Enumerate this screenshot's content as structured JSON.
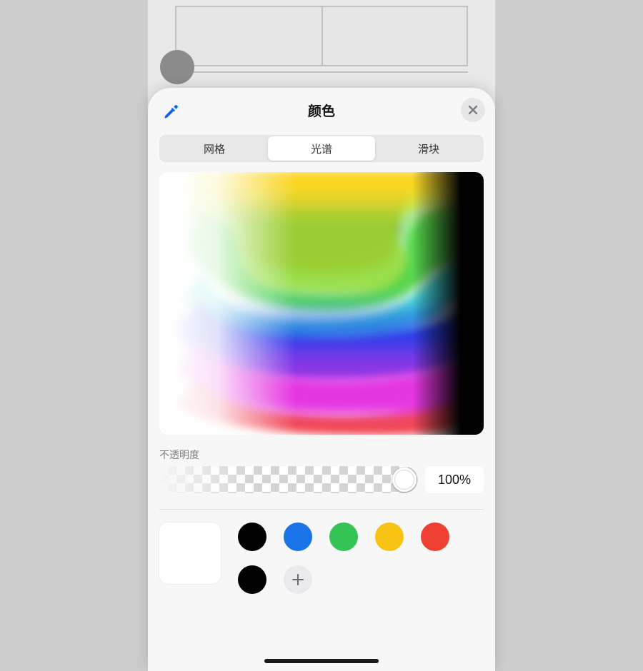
{
  "sheet": {
    "title": "颜色",
    "tabs": [
      {
        "label": "网格"
      },
      {
        "label": "光谱"
      },
      {
        "label": "滑块"
      }
    ],
    "active_tab_index": 1,
    "opacity": {
      "label": "不透明度",
      "value": "100%"
    },
    "current_color": "#ffffff",
    "swatches": [
      "#000000",
      "#1b73e8",
      "#34c456",
      "#f8c313",
      "#ef3f33",
      "#000000"
    ]
  }
}
